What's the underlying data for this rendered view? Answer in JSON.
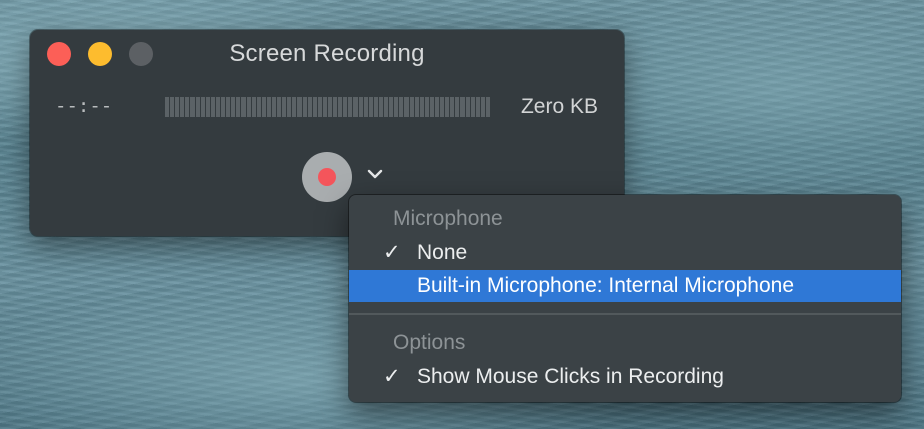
{
  "window": {
    "title": "Screen Recording",
    "elapsed_time": "--:--",
    "file_size": "Zero KB"
  },
  "controls": {
    "record_icon": "record-icon",
    "options_icon": "chevron-down-icon"
  },
  "menu": {
    "microphone_header": "Microphone",
    "microphone_items": [
      {
        "label": "None",
        "checked": true,
        "check_mark": "✓"
      },
      {
        "label": "Built-in Microphone: Internal Microphone",
        "checked": false,
        "highlighted": true
      }
    ],
    "options_header": "Options",
    "option_items": [
      {
        "label": "Show Mouse Clicks in Recording",
        "checked": true,
        "check_mark": "✓"
      }
    ]
  },
  "colors": {
    "close": "#fc5f57",
    "minimize": "#fdbc2e",
    "zoom": "#5c6064",
    "record_dot": "#f4555b",
    "highlight": "#2f78d6"
  }
}
